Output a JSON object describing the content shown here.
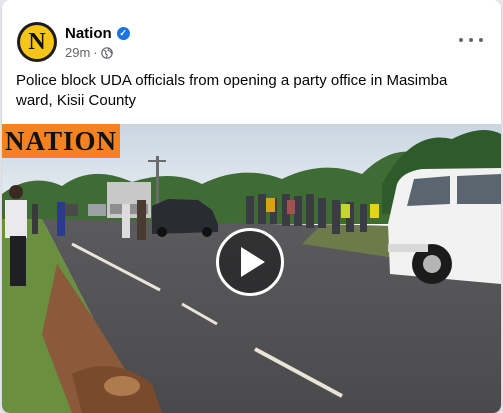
{
  "post": {
    "page_name": "Nation",
    "avatar_letter": "N",
    "time": "29m",
    "separator": "·",
    "privacy_icon": "globe-icon",
    "verified_icon": "verified-badge-icon",
    "more_icon": "more-options-icon",
    "caption": "Police block UDA officials from opening a party office in Masimba ward, Kisii County"
  },
  "video": {
    "logo_text": "NATION",
    "play_icon": "play-icon",
    "accent_color": "#f58220"
  }
}
